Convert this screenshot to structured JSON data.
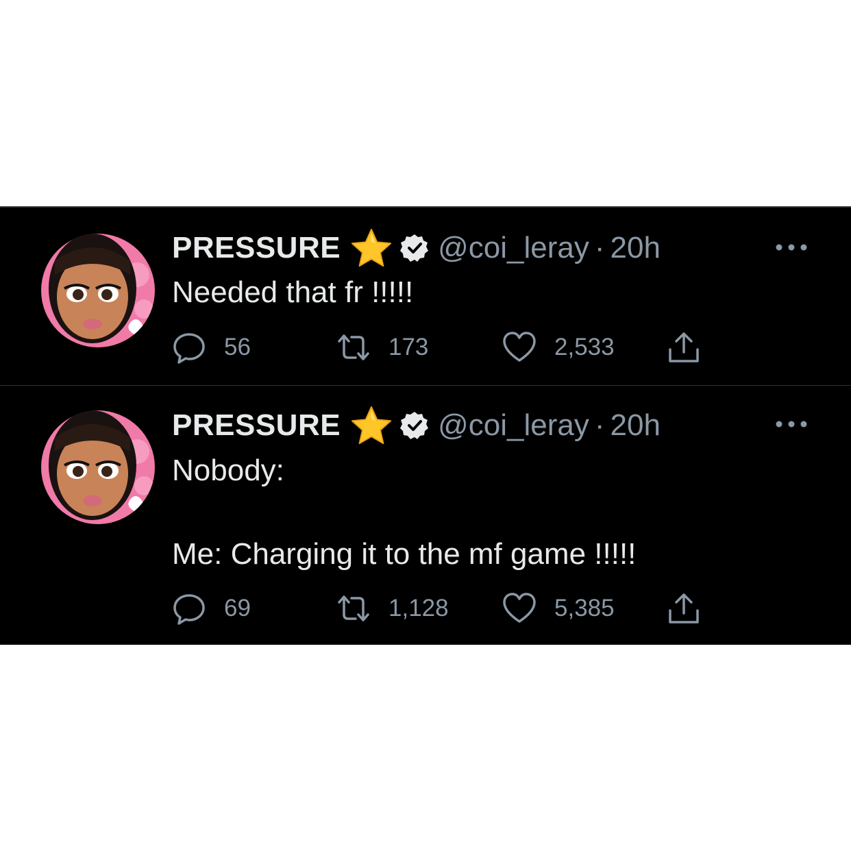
{
  "tweets": [
    {
      "display_name": "PRESSURE",
      "handle": "@coi_leray",
      "separator": "·",
      "time": "20h",
      "text": "Needed that fr !!!!!",
      "replies": "56",
      "retweets": "173",
      "likes": "2,533"
    },
    {
      "display_name": "PRESSURE",
      "handle": "@coi_leray",
      "separator": "·",
      "time": "20h",
      "text": "Nobody:\n\nMe: Charging it to the mf game !!!!!",
      "replies": "69",
      "retweets": "1,128",
      "likes": "5,385"
    }
  ],
  "icons": [
    "avatar",
    "star-emoji",
    "verified-badge-icon",
    "more-icon",
    "reply-icon",
    "retweet-icon",
    "like-icon",
    "share-icon"
  ],
  "colors": {
    "background": "#000000",
    "primary_text": "#e7e9ea",
    "secondary_text": "#8b98a5",
    "divider": "#2f3336"
  }
}
